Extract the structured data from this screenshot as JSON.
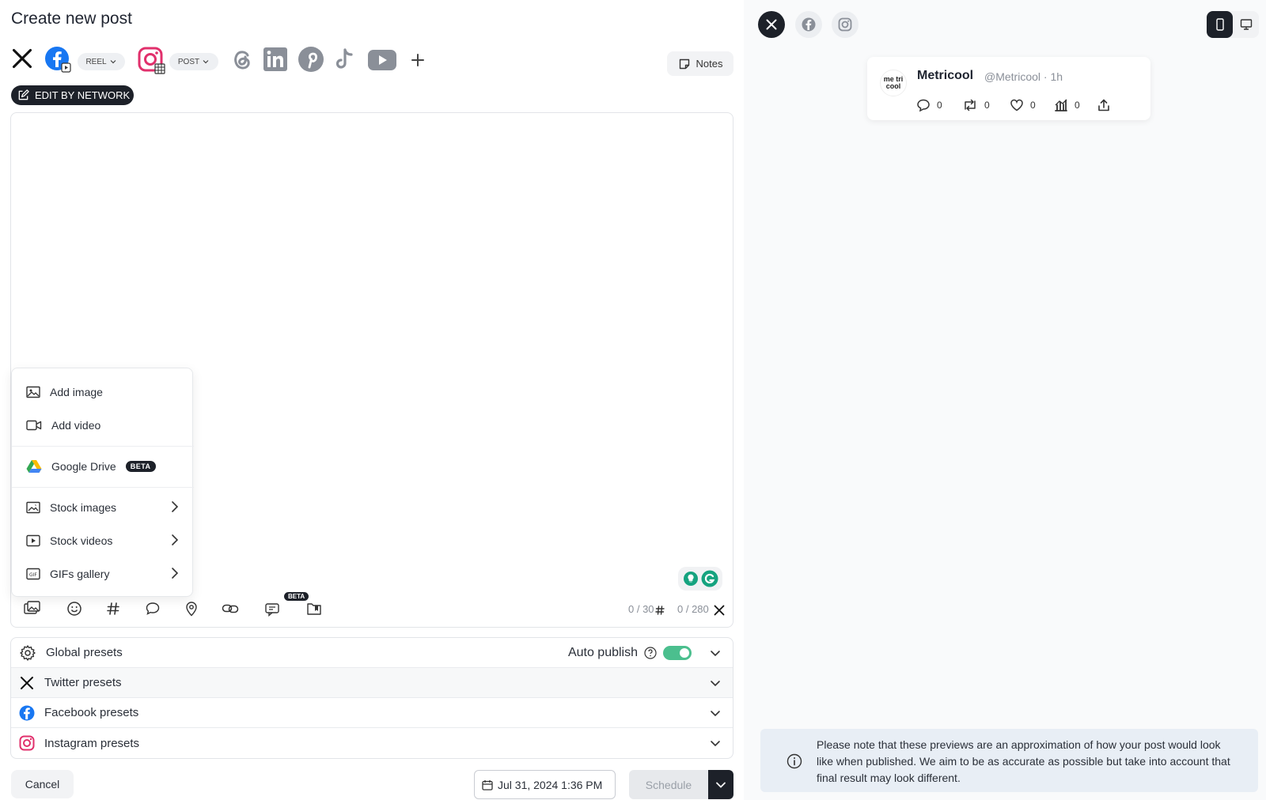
{
  "page": {
    "title": "Create new post"
  },
  "networks": {
    "facebook_type": "REEL",
    "instagram_type": "POST"
  },
  "notes": {
    "label": "Notes"
  },
  "edit_by_network": {
    "label": "EDIT BY NETWORK"
  },
  "media_menu": {
    "items": [
      {
        "label": "Add image",
        "icon": "image-icon"
      },
      {
        "label": "Add video",
        "icon": "video-icon"
      },
      {
        "label": "Google Drive",
        "icon": "google-drive-icon",
        "badge": "BETA"
      },
      {
        "label": "Stock images",
        "icon": "stock-image-icon"
      },
      {
        "label": "Stock videos",
        "icon": "stock-video-icon"
      },
      {
        "label": "GIFs gallery",
        "icon": "gif-icon"
      }
    ]
  },
  "toolbar": {
    "beta_label": "BETA",
    "hashtag_counter": "0 / 30",
    "char_counter": "0 / 280"
  },
  "presets": {
    "global": "Global presets",
    "auto_publish": "Auto publish",
    "twitter": "Twitter presets",
    "facebook": "Facebook presets",
    "instagram": "Instagram presets"
  },
  "footer": {
    "cancel": "Cancel",
    "date": "Jul 31, 2024 1:36 PM",
    "schedule": "Schedule"
  },
  "preview": {
    "logo_text": "me tri cool",
    "account_name": "Metricool",
    "handle": "@Metricool · 1h",
    "metrics": {
      "replies": "0",
      "retweets": "0",
      "likes": "0",
      "views": "0"
    },
    "note": "Please note that these previews are an approximation of how your post would look like when published. We aim to be as accurate as possible but take into account that final result may look different."
  },
  "colors": {
    "facebook": "#1877f2",
    "instagram": "#e1306c",
    "toggle_on": "#4bbf8e",
    "dark": "#1d2129",
    "muted_network": "#8a8f98"
  }
}
